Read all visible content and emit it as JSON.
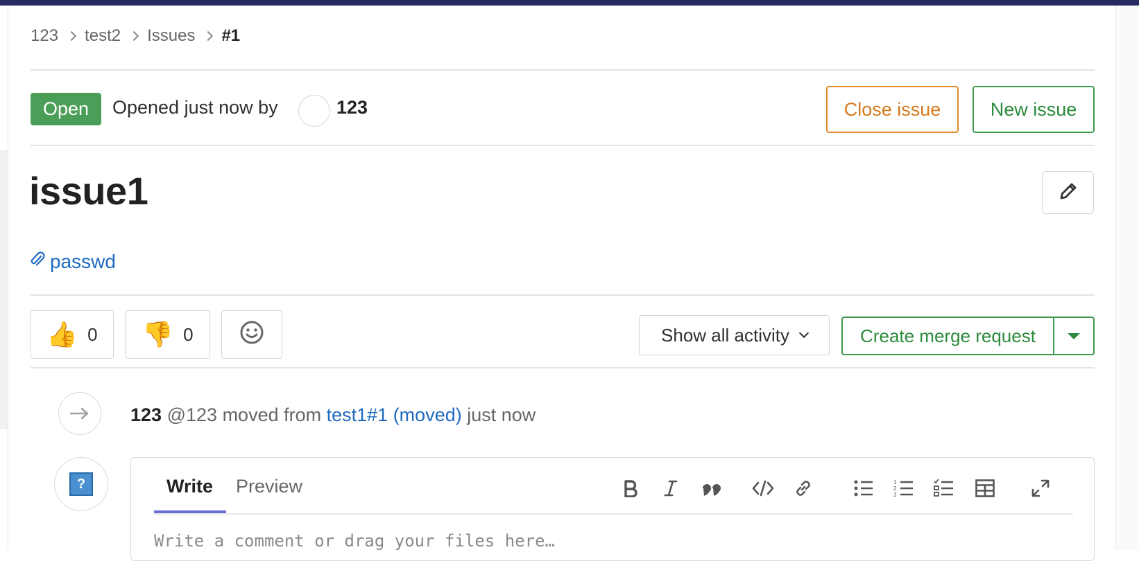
{
  "breadcrumb": {
    "items": [
      "123",
      "test2",
      "Issues"
    ],
    "current": "#1"
  },
  "issue": {
    "status": "Open",
    "opened_text": "Opened just now by",
    "author": "123",
    "title": "issue1",
    "attachment": "passwd"
  },
  "actions": {
    "close_label": "Close issue",
    "new_label": "New issue"
  },
  "reactions": {
    "thumbs_up_count": "0",
    "thumbs_down_count": "0"
  },
  "toolbar": {
    "activity_label": "Show all activity",
    "merge_label": "Create merge request"
  },
  "timeline": {
    "author": "123",
    "handle": "@123",
    "action": "moved from",
    "link": "test1#1 (moved)",
    "time": "just now"
  },
  "editor": {
    "tab_write": "Write",
    "tab_preview": "Preview",
    "placeholder": "Write a comment or drag your files here…"
  },
  "colors": {
    "open_green": "#4b9e57",
    "close_orange": "#e08a2a",
    "link_blue": "#1f6ac0",
    "top_bar": "#292961"
  }
}
